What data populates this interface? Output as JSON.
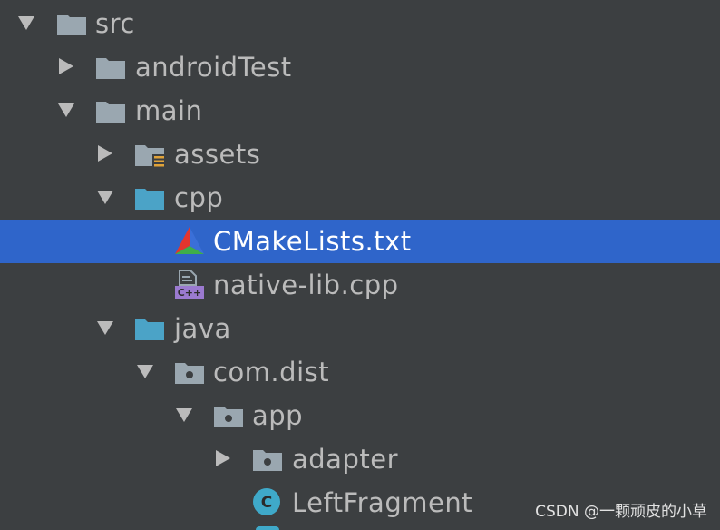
{
  "tree": {
    "src": {
      "label": "src",
      "icon": "folder-icon",
      "state": "expanded"
    },
    "androidTest": {
      "label": "androidTest",
      "icon": "folder-icon",
      "state": "collapsed"
    },
    "main": {
      "label": "main",
      "icon": "folder-icon",
      "state": "expanded"
    },
    "assets": {
      "label": "assets",
      "icon": "assets-folder-icon",
      "state": "collapsed"
    },
    "cpp": {
      "label": "cpp",
      "icon": "source-folder-icon",
      "state": "expanded"
    },
    "cmakelists": {
      "label": "CMakeLists.txt",
      "icon": "cmake-icon",
      "selected": true
    },
    "nativelib": {
      "label": "native-lib.cpp",
      "icon": "cpp-file-icon"
    },
    "java": {
      "label": "java",
      "icon": "source-folder-icon",
      "state": "expanded"
    },
    "comdist": {
      "label": "com.dist",
      "icon": "package-icon",
      "state": "expanded"
    },
    "app": {
      "label": "app",
      "icon": "package-icon",
      "state": "expanded"
    },
    "adapter": {
      "label": "adapter",
      "icon": "package-icon",
      "state": "collapsed"
    },
    "leftfragment": {
      "label": "LeftFragment",
      "icon": "class-icon"
    }
  },
  "watermark": {
    "text": "CSDN @一颗顽皮的小草"
  },
  "colors": {
    "background": "#3c3f41",
    "selection": "#2f65ca",
    "text": "#bbbbbb",
    "folder": "#9aa7b0",
    "source_folder": "#4ba3c7",
    "class": "#3fa9c9"
  }
}
